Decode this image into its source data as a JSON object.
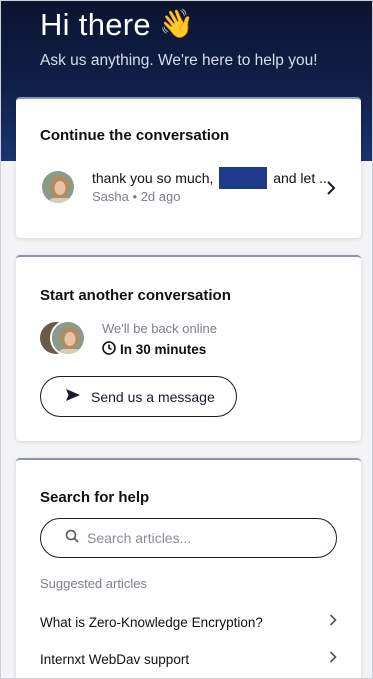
{
  "header": {
    "greeting": "Hi there",
    "wave": "👋",
    "subtitle": "Ask us anything. We're here to help you!"
  },
  "continue": {
    "title": "Continue the conversation",
    "message_start": "thank you so much,",
    "message_end": "and let ...",
    "author": "Sasha",
    "separator": "•",
    "time_ago": "2d ago",
    "avatar_icon": "avatar-photo"
  },
  "start": {
    "title": "Start another conversation",
    "status": "We'll be back online",
    "eta": "In 30 minutes",
    "button_label": "Send us a message",
    "button_icon": "send-icon",
    "clock_icon": "clock-icon"
  },
  "help": {
    "title": "Search for help",
    "search_placeholder": "Search articles...",
    "suggested_label": "Suggested articles",
    "articles": [
      {
        "label": "What is Zero-Knowledge Encryption?"
      },
      {
        "label": "Internxt WebDav support"
      }
    ]
  },
  "colors": {
    "hero_top": "#0b1430",
    "hero_bottom": "#1a3470",
    "redaction": "#1f3a8a",
    "text_muted": "#7b7f8a"
  }
}
